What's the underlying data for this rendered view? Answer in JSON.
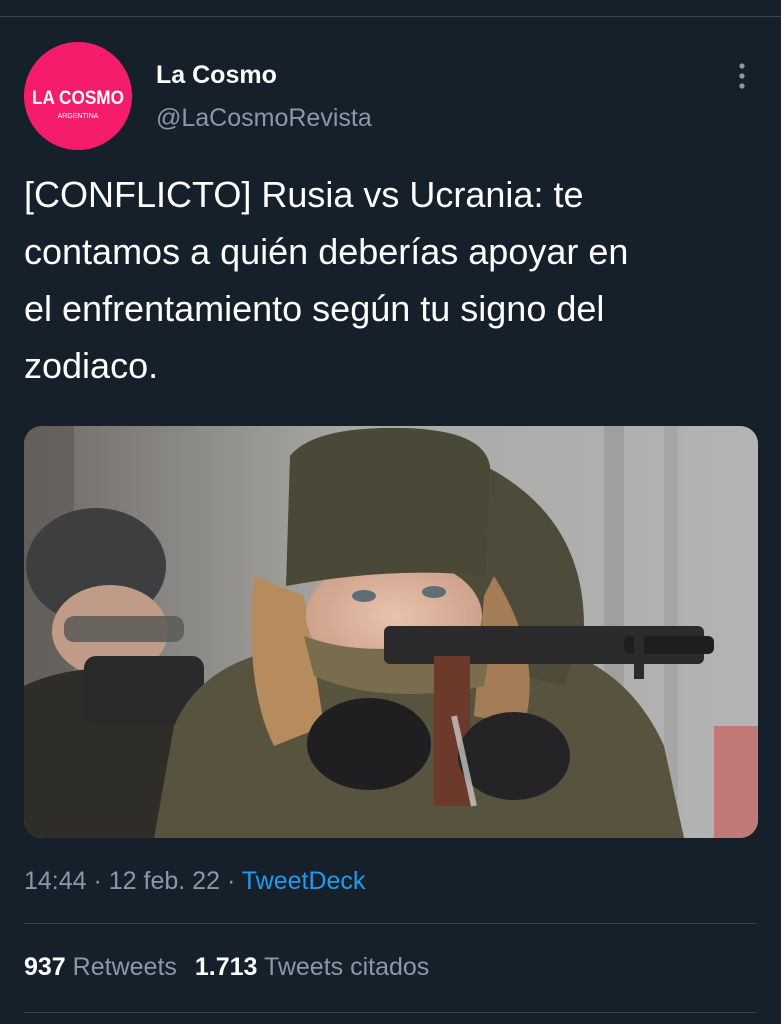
{
  "tweet": {
    "author": {
      "name": "La Cosmo",
      "handle": "@LaCosmoRevista",
      "avatar_logo_text": "LA COSMO",
      "avatar_logo_subtext": "ARGENTINA"
    },
    "more_icon": "more-vertical-icon",
    "text_lines": [
      "[CONFLICTO] Rusia vs Ucrania: te",
      "contamos a quién deberías apoyar en",
      "el enfrentamiento según tu signo del",
      "zodiaco."
    ],
    "media": {
      "kind": "photo"
    },
    "time": "14:44",
    "date": "12 feb. 22",
    "separator": " · ",
    "source": "TweetDeck",
    "stats": {
      "retweets_count": "937",
      "retweets_label": "Retweets",
      "quotes_count": "1.713",
      "quotes_label": "Tweets citados"
    }
  },
  "colors": {
    "background": "#15202b",
    "text_primary": "#ffffff",
    "text_secondary": "#8b98a5",
    "accent": "#1d9bf0",
    "divider": "#38444d",
    "avatar_brand": "#f51d6b"
  }
}
